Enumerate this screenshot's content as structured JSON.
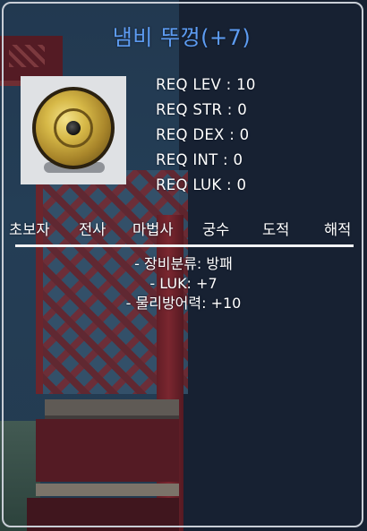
{
  "item": {
    "name": "냄비 뚜껑(+7)",
    "icon": "pot-lid-shield-icon",
    "name_color": "#5d9cf2"
  },
  "requirements": [
    "REQ LEV : 10",
    "REQ STR : 0",
    "REQ DEX : 0",
    "REQ INT : 0",
    "REQ LUK : 0"
  ],
  "jobs": [
    "초보자",
    "전사",
    "마법사",
    "궁수",
    "도적",
    "해적"
  ],
  "stats": [
    "- 장비분류: 방패",
    "- LUK: +7",
    "- 물리방어력: +10"
  ]
}
